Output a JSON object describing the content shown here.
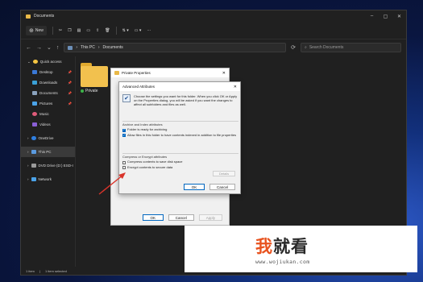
{
  "window": {
    "title": "Documents",
    "controls": [
      "–",
      "▢",
      "✕"
    ]
  },
  "toolbar": {
    "new_label": "New",
    "sort_caret": "⇅ ▾",
    "view_caret": "▭ ▾",
    "more": "···"
  },
  "address": {
    "path": [
      "This PC",
      "Documents"
    ],
    "separator": "›",
    "search_placeholder": "Search Documents"
  },
  "sidebar": {
    "items": [
      {
        "label": "Quick access",
        "color": "#f5c542",
        "pinned": false
      },
      {
        "label": "Desktop",
        "color": "#3a78d6",
        "pinned": true
      },
      {
        "label": "Downloads",
        "color": "#3aa0d6",
        "pinned": true
      },
      {
        "label": "Documents",
        "color": "#8aa2bd",
        "pinned": true
      },
      {
        "label": "Pictures",
        "color": "#4ba3e8",
        "pinned": true
      },
      {
        "label": "Music",
        "color": "#e05b7a",
        "pinned": false
      },
      {
        "label": "Videos",
        "color": "#8a5fd6",
        "pinned": false
      },
      {
        "label": "OneDrive",
        "color": "#2f7fe0",
        "pinned": false
      },
      {
        "label": "This PC",
        "color": "#5b9be0",
        "pinned": false
      },
      {
        "label": "DVD Drive (D:) ESD-I",
        "color": "#9a9a9a",
        "pinned": false
      },
      {
        "label": "Network",
        "color": "#4ba3e8",
        "pinned": false
      }
    ]
  },
  "content": {
    "folder_label": "Private"
  },
  "status": {
    "count": "1 item",
    "selected": "1 item selected"
  },
  "properties": {
    "title": "Private Properties",
    "ok": "OK",
    "cancel": "Cancel",
    "apply": "Apply"
  },
  "advanced": {
    "title": "Advanced Attributes",
    "intro": "Choose the settings you want for this folder. When you click OK or Apply on the Properties dialog, you will be asked if you want the changes to affect all subfolders and files as well.",
    "archive_group": "Archive and Index attributes",
    "archive_ready": "Folder is ready for archiving",
    "index_label": "Allow files in this folder to have contents indexed in addition to file properties",
    "compress_group": "Compress or Encrypt attributes",
    "compress_label": "Compress contents to save disk space",
    "encrypt_label": "Encrypt contents to secure data",
    "details": "Details",
    "ok": "OK",
    "cancel": "Cancel"
  },
  "watermark": {
    "title_first": "我",
    "title_rest": "就看",
    "url": "www.wojiukan.com"
  },
  "colors": {
    "accent": "#0067c0",
    "arrow": "#d9342b"
  }
}
